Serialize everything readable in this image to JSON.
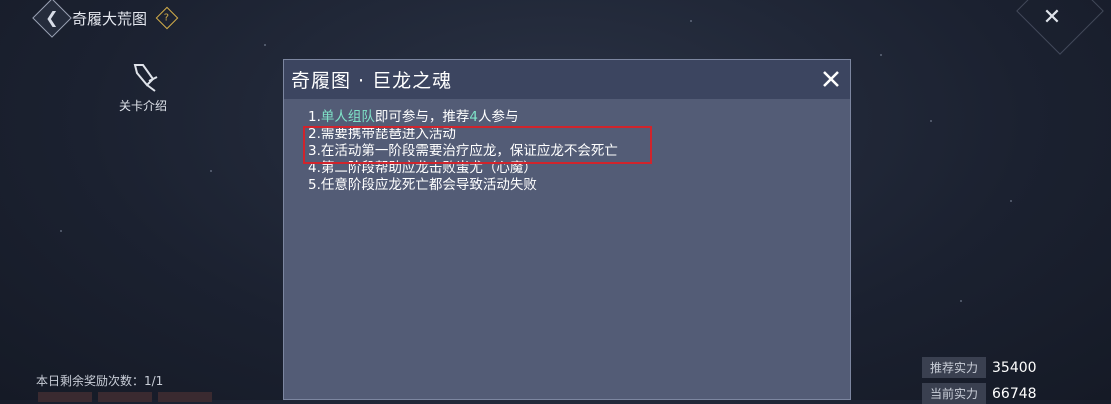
{
  "header": {
    "title": "奇履大荒图",
    "help_glyph": "?"
  },
  "sidebar": {
    "intro_label": "关卡介绍",
    "reward_text": "本日剩余奖励次数：1/1"
  },
  "modal": {
    "title": "奇履图 · 巨龙之魂",
    "rules": [
      {
        "prefix": "1.",
        "highlight": "单人组队",
        "mid": "即可参与，推荐",
        "highlight2": "4",
        "suffix": "人参与"
      },
      {
        "text": "2.需要携带琵琶进入活动"
      },
      {
        "text": "3.在活动第一阶段需要治疗应龙，保证应龙不会死亡"
      },
      {
        "text": "4.第二阶段帮助应龙击败蚩尤（心魔）"
      },
      {
        "text": "5.任意阶段应龙死亡都会导致活动失败"
      }
    ],
    "highlight_color": "#7fe3c8",
    "annotation_color": "#d0242c"
  },
  "stats": {
    "recommended_label": "推荐实力",
    "recommended_value": "35400",
    "current_label": "当前实力",
    "current_value": "66748"
  }
}
